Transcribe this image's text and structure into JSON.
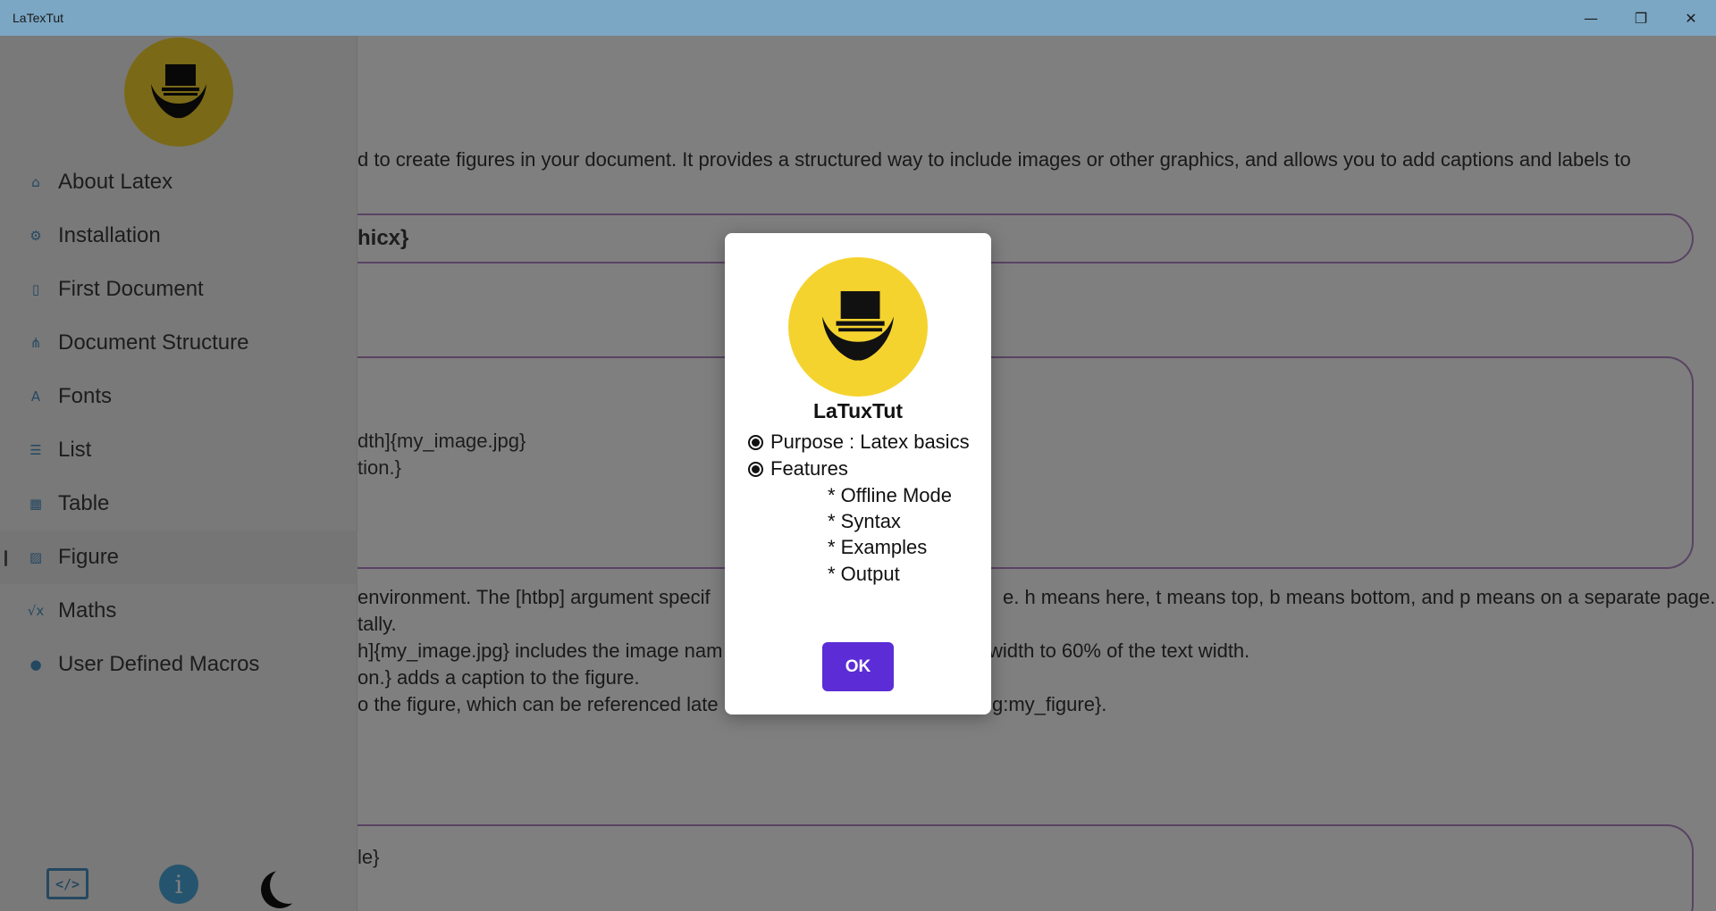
{
  "window": {
    "title": "LaTexTut",
    "minimize_glyph": "—",
    "maximize_glyph": "❐",
    "close_glyph": "✕"
  },
  "sidebar": {
    "logo_icon": "laptop-hand-logo",
    "items": [
      {
        "label": "About Latex",
        "icon": "home-icon",
        "glyph": "⌂"
      },
      {
        "label": "Installation",
        "icon": "gears-icon",
        "glyph": "⚙"
      },
      {
        "label": "First Document",
        "icon": "document-icon",
        "glyph": "▯"
      },
      {
        "label": "Document Structure",
        "icon": "hierarchy-icon",
        "glyph": "⋔"
      },
      {
        "label": "Fonts",
        "icon": "font-icon",
        "glyph": "A"
      },
      {
        "label": "List",
        "icon": "list-icon",
        "glyph": "☰"
      },
      {
        "label": "Table",
        "icon": "table-icon",
        "glyph": "▦"
      },
      {
        "label": "Figure",
        "icon": "image-icon",
        "glyph": "▨"
      },
      {
        "label": "Maths",
        "icon": "sqrt-icon",
        "glyph": "√x"
      },
      {
        "label": "User Defined Macros",
        "icon": "user-icon",
        "glyph": "●"
      }
    ],
    "active_index": 7,
    "bottom": {
      "code_label": "</>",
      "info_label": "i"
    }
  },
  "content": {
    "paragraph1": "d to create figures in your document. It provides a structured way to include images or other graphics, and allows you to add captions and labels to",
    "code1": "hicx}",
    "code2_lines": [
      "dth]{my_image.jpg}",
      "tion.}"
    ],
    "explanation": [
      "environment. The [htbp] argument specif",
      "tally.",
      "h]{my_image.jpg} includes the image nam",
      "on.} adds a caption to the figure.",
      "o the figure, which can be referenced late"
    ],
    "explanation_right": [
      "e. h means here, t means top, b means bottom, and p means on a separate page.",
      "",
      "width to 60% of the text width.",
      "",
      "g:my_figure}."
    ],
    "code3": "le}"
  },
  "dialog": {
    "title": "LaTuxTut",
    "purpose_label": "Purpose  : Latex basics",
    "features_label": "Features",
    "features": [
      "* Offline Mode",
      "* Syntax",
      "* Examples",
      "* Output"
    ],
    "ok_label": "OK"
  }
}
